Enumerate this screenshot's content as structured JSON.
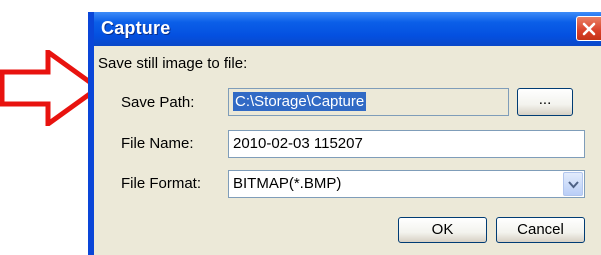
{
  "dialog": {
    "title": "Capture",
    "intro": "Save still image to file:"
  },
  "fields": {
    "save_path_label": "Save Path:",
    "save_path_value": "C:\\Storage\\Capture",
    "browse_label": "...",
    "file_name_label": "File Name:",
    "file_name_value": "2010-02-03 115207",
    "file_format_label": "File Format:",
    "file_format_value": "BITMAP(*.BMP)"
  },
  "buttons": {
    "ok": "OK",
    "cancel": "Cancel"
  },
  "colors": {
    "arrow": "#e8130f",
    "titlebar": "#0450e0",
    "selection": "#316ac5",
    "close": "#d9412a"
  }
}
